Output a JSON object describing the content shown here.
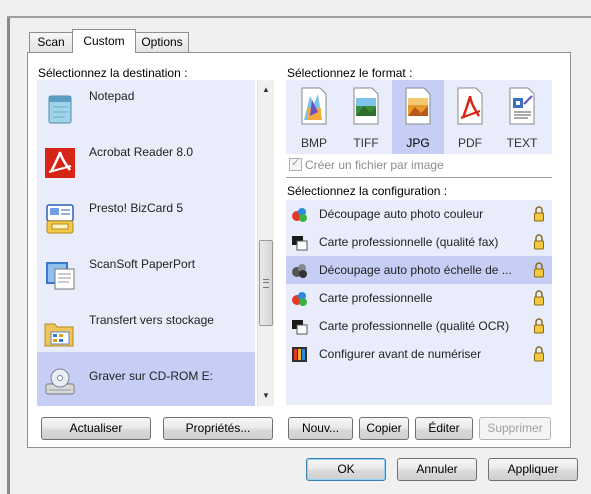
{
  "tabs": [
    {
      "label": "Scan",
      "active": false
    },
    {
      "label": "Custom",
      "active": true
    },
    {
      "label": "Options",
      "active": false
    }
  ],
  "destination": {
    "label": "Sélectionnez la destination :",
    "items": [
      {
        "label": "Notepad",
        "icon": "notepad-icon",
        "selected": false
      },
      {
        "label": "Acrobat Reader 8.0",
        "icon": "acrobat-reader-icon",
        "selected": false
      },
      {
        "label": "Presto! BizCard 5",
        "icon": "bizcard-icon",
        "selected": false
      },
      {
        "label": "ScanSoft PaperPort",
        "icon": "paperport-icon",
        "selected": false
      },
      {
        "label": "Transfert vers stockage",
        "icon": "storage-folder-icon",
        "selected": false
      },
      {
        "label": "Graver sur CD-ROM  E:",
        "icon": "cd-drive-icon",
        "selected": true
      }
    ],
    "buttons": {
      "refresh": "Actualiser",
      "properties": "Propriétés..."
    }
  },
  "format": {
    "label": "Sélectionnez le format :",
    "items": [
      {
        "label": "BMP",
        "icon": "bmp-file-icon",
        "selected": false
      },
      {
        "label": "TIFF",
        "icon": "tiff-file-icon",
        "selected": false
      },
      {
        "label": "JPG",
        "icon": "jpg-file-icon",
        "selected": true
      },
      {
        "label": "PDF",
        "icon": "pdf-file-icon",
        "selected": false
      },
      {
        "label": "TEXT",
        "icon": "text-file-icon",
        "selected": false
      }
    ],
    "checkbox_label": "Créer un fichier par image",
    "checkbox_checked": true,
    "checkbox_enabled": false
  },
  "configuration": {
    "label": "Sélectionnez la configuration :",
    "items": [
      {
        "label": "Découpage auto photo couleur",
        "icon": "color-photo-icon",
        "locked": true,
        "selected": false
      },
      {
        "label": "Carte professionnelle (qualité fax)",
        "icon": "bw-document-icon",
        "locked": true,
        "selected": false
      },
      {
        "label": "Découpage auto photo échelle de ...",
        "icon": "grayscale-photo-icon",
        "locked": true,
        "selected": true
      },
      {
        "label": "Carte professionnelle",
        "icon": "color-photo-icon",
        "locked": true,
        "selected": false
      },
      {
        "label": "Carte professionnelle (qualité OCR)",
        "icon": "bw-document-icon",
        "locked": true,
        "selected": false
      },
      {
        "label": "Configurer avant de numériser",
        "icon": "configure-scan-icon",
        "locked": true,
        "selected": false
      }
    ],
    "buttons": {
      "new": "Nouv...",
      "copy": "Copier",
      "edit": "Éditer",
      "delete": "Supprimer"
    }
  },
  "dialog_buttons": {
    "ok": "OK",
    "cancel": "Annuler",
    "apply": "Appliquer"
  },
  "colors": {
    "list_bg": "#e8ecfb",
    "selected_bg": "#c6cef5",
    "default_button_border": "#3c7fb1"
  }
}
